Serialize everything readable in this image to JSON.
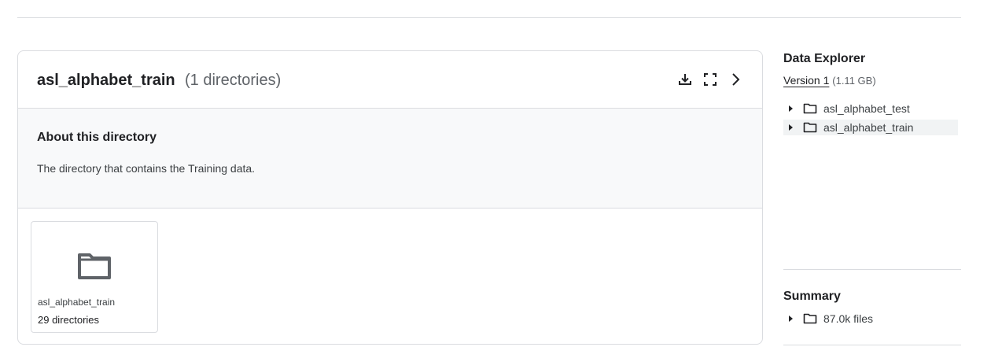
{
  "main": {
    "title": "asl_alphabet_train",
    "subtitle": "(1 directories)",
    "about": {
      "heading": "About this directory",
      "description": "The directory that contains the Training data."
    },
    "tiles": [
      {
        "name": "asl_alphabet_train",
        "count": "29 directories",
        "icon": "folder-icon"
      }
    ],
    "actions": [
      {
        "icon": "download-icon"
      },
      {
        "icon": "fullscreen-icon"
      },
      {
        "icon": "chevron-right-icon"
      }
    ]
  },
  "sidebar": {
    "title": "Data Explorer",
    "version_label": "Version 1",
    "version_size": "(1.11 GB)",
    "tree": [
      {
        "label": "asl_alphabet_test",
        "icon": "folder-icon",
        "selected": false
      },
      {
        "label": "asl_alphabet_train",
        "icon": "folder-icon",
        "selected": true
      }
    ]
  },
  "summary": {
    "title": "Summary",
    "files_label": "87.0k files"
  },
  "colors": {
    "border": "#dadce0",
    "about_bg": "#f8f9fa",
    "selected_bg": "#f1f3f4",
    "icon": "#5f6368"
  }
}
